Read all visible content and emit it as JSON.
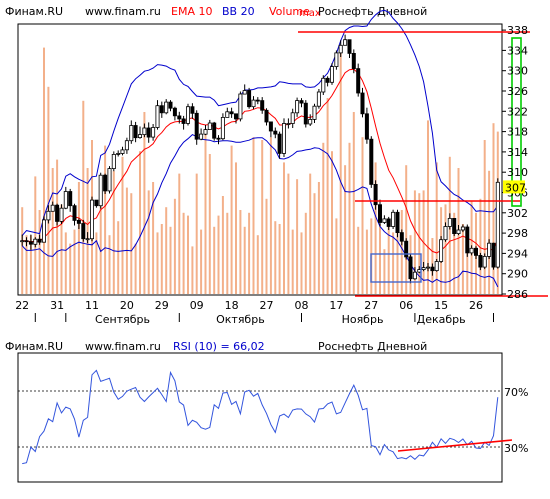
{
  "colors": {
    "background": "#ffffff",
    "plot_bg": "#ffffff",
    "candle": "#000000",
    "ema": "#ff0000",
    "bb": "#0000cc",
    "volume": "#f3b08a",
    "rsi": "#3355dd",
    "annotation_red": "#ff0000",
    "price_tag_bg": "#ffff00",
    "highlight_box": "#4466cc",
    "green_bracket": "#00cc00"
  },
  "main_header": {
    "source": "Финам.RU",
    "url": "www.finam.ru",
    "ema": "EMA 10",
    "bb": "BB 20",
    "volume": "Volume",
    "volume_max": "max",
    "ticker": "Роснефть Дневной"
  },
  "rsi_header": {
    "source": "Финам.RU",
    "url": "www.finam.ru",
    "indicator": "RSI (10) = 66,02",
    "ticker": "Роснефть Дневной"
  },
  "price_axis": {
    "ticks": [
      "338",
      "334",
      "330",
      "326",
      "322",
      "318",
      "314",
      "310",
      "306",
      "302",
      "298",
      "294",
      "290",
      "286"
    ],
    "last_price": "307"
  },
  "date_axis": {
    "day_labels": [
      "22",
      "31",
      "11",
      "20",
      "29",
      "09",
      "18",
      "27",
      "08",
      "17",
      "27",
      "06",
      "15",
      "26"
    ],
    "month_labels": [
      "Сентябрь",
      "Октябрь",
      "Ноябрь",
      "Декабрь"
    ]
  },
  "rsi_axis": {
    "levels": [
      "70%",
      "30%"
    ]
  },
  "chart_data": [
    {
      "type": "candlestick",
      "title": "Роснефть Дневной",
      "ylim": [
        286,
        339
      ],
      "x_count": 110,
      "close": [
        296.5,
        296.3,
        295.8,
        296.8,
        296.2,
        300.6,
        302.3,
        303.5,
        300.3,
        302.9,
        306.2,
        303.4,
        300.5,
        299.9,
        296.9,
        296.9,
        304.5,
        303.4,
        309.4,
        306.3,
        310.7,
        313.5,
        313.7,
        314.4,
        316.2,
        319.2,
        316.8,
        317.4,
        318.7,
        316.9,
        318.8,
        323.1,
        321.7,
        323.8,
        322.6,
        321.1,
        320.5,
        319.6,
        322.9,
        321.6,
        316.5,
        317.5,
        318.4,
        319.7,
        316.7,
        316.6,
        320.8,
        321.9,
        321.5,
        320.5,
        325.4,
        326.1,
        322.9,
        324.2,
        324.1,
        322.2,
        319.9,
        318.1,
        317.5,
        313.7,
        319.6,
        319.6,
        321.7,
        324.1,
        323.6,
        319.5,
        320.4,
        323.0,
        325.8,
        328.5,
        327.7,
        330.8,
        333.5,
        335.0,
        336.1,
        333.4,
        330.4,
        325.6,
        321.5,
        316.5,
        307.6,
        303.6,
        300.1,
        300.8,
        299.3,
        302.1,
        298.1,
        296.4,
        293.3,
        289.0,
        290.3,
        290.8,
        291.2,
        291.3,
        290.6,
        292.4,
        296.7,
        299.3,
        300.9,
        297.9,
        298.6,
        299.2,
        294.1,
        295.0,
        293.6,
        291.3,
        293.4,
        296.0,
        291.3,
        308.0
      ],
      "high": [
        297.7,
        297.2,
        297.7,
        297.2,
        297.7,
        301.3,
        303.5,
        304.2,
        303.8,
        303.7,
        307.1,
        306.7,
        303.8,
        300.9,
        300.6,
        298.2,
        305.2,
        304.4,
        309.9,
        309.7,
        311.2,
        314.1,
        314.3,
        315.0,
        316.8,
        320.2,
        319.9,
        319.0,
        319.6,
        319.8,
        319.5,
        324.2,
        323.9,
        324.4,
        324.2,
        322.9,
        321.9,
        321.1,
        323.5,
        323.6,
        322.2,
        318.6,
        319.3,
        320.3,
        319.9,
        317.3,
        321.6,
        322.7,
        322.7,
        321.3,
        325.9,
        327.3,
        326.6,
        325.0,
        324.8,
        324.8,
        322.6,
        319.4,
        318.8,
        318.0,
        320.6,
        320.6,
        322.5,
        324.7,
        324.6,
        324.2,
        321.4,
        323.5,
        326.4,
        329.1,
        328.9,
        331.5,
        334.0,
        336.0,
        337.1,
        336.0,
        334.2,
        331.4,
        326.6,
        322.7,
        317.1,
        308.4,
        304.6,
        301.5,
        301.2,
        302.6,
        302.6,
        298.7,
        297.0,
        293.9,
        291.3,
        291.5,
        292.3,
        292.1,
        292.0,
        292.9,
        297.4,
        300.1,
        301.9,
        300.7,
        299.6,
        299.7,
        299.7,
        295.6,
        295.4,
        294.1,
        294.0,
        296.8,
        296.1,
        308.8
      ],
      "low": [
        295.5,
        295.4,
        294.7,
        295.2,
        295.7,
        296.2,
        299.9,
        303.0,
        299.5,
        299.8,
        302.7,
        302.2,
        299.5,
        298.8,
        296.3,
        296.0,
        296.4,
        303.0,
        302.8,
        305.7,
        305.8,
        310.2,
        313.1,
        313.3,
        313.6,
        315.6,
        315.9,
        316.6,
        316.9,
        315.8,
        316.2,
        318.4,
        320.7,
        321.4,
        322.0,
        320.2,
        319.6,
        318.4,
        319.2,
        320.5,
        315.4,
        316.3,
        317.3,
        318.4,
        316.2,
        315.5,
        316.3,
        320.9,
        320.7,
        319.6,
        320.0,
        325.3,
        322.5,
        322.4,
        323.4,
        321.5,
        319.2,
        316.9,
        316.7,
        312.7,
        313.0,
        318.6,
        318.7,
        320.9,
        322.8,
        318.8,
        319.1,
        319.7,
        322.5,
        325.2,
        326.9,
        327.2,
        330.2,
        332.7,
        335.0,
        332.5,
        329.5,
        324.9,
        320.8,
        315.6,
        306.9,
        302.6,
        299.4,
        299.8,
        298.6,
        298.8,
        297.2,
        295.6,
        292.8,
        288.1,
        288.8,
        290.1,
        290.5,
        290.5,
        289.6,
        290.4,
        292.1,
        296.3,
        298.7,
        297.4,
        297.6,
        298.2,
        293.3,
        293.6,
        292.9,
        290.7,
        290.9,
        292.9,
        290.8,
        291.0
      ],
      "ema": [
        296.5,
        296.5,
        296.3,
        296.4,
        296.4,
        297.1,
        298.0,
        299.0,
        299.2,
        299.8,
        300.9,
        301.4,
        301.2,
        301.0,
        300.3,
        299.7,
        300.6,
        301.0,
        302.6,
        303.3,
        304.6,
        306.2,
        307.6,
        308.9,
        310.2,
        312.0,
        312.8,
        313.6,
        314.5,
        314.9,
        315.6,
        317.0,
        317.8,
        318.9,
        319.6,
        319.9,
        320.0,
        320.0,
        320.5,
        320.7,
        319.9,
        319.5,
        319.3,
        319.4,
        318.9,
        318.5,
        318.9,
        319.5,
        319.9,
        320.0,
        321.0,
        322.0,
        322.1,
        322.4,
        322.7,
        322.6,
        322.1,
        321.3,
        320.6,
        319.3,
        319.3,
        319.4,
        319.8,
        320.6,
        321.1,
        320.8,
        320.8,
        321.1,
        321.9,
        323.1,
        323.9,
        325.1,
        326.6,
        328.1,
        329.6,
        330.2,
        330.3,
        329.5,
        328.0,
        325.9,
        322.6,
        319.1,
        315.7,
        312.9,
        310.4,
        308.9,
        307.0,
        305.1,
        303.0,
        300.4,
        298.6,
        297.2,
        296.1,
        295.2,
        294.4,
        294.1,
        294.6,
        295.4,
        296.4,
        296.7,
        297.0,
        297.4,
        297.0,
        296.6,
        296.0,
        295.1,
        294.8,
        295.0,
        294.5,
        296.9
      ],
      "bb_upper": [
        297.5,
        298.5,
        298.3,
        298.1,
        297.9,
        301.3,
        303.8,
        305.9,
        305.7,
        306.7,
        309.2,
        309.7,
        309.1,
        308.6,
        308.2,
        307.8,
        309.1,
        309.2,
        313.3,
        313.8,
        315.5,
        318.1,
        320.6,
        322.8,
        325.1,
        327.4,
        328.4,
        329.1,
        329.9,
        330.1,
        330.5,
        331.2,
        331.1,
        330.9,
        330.4,
        330.1,
        328.3,
        327.3,
        326.9,
        325.9,
        325.0,
        324.9,
        324.8,
        324.8,
        324.2,
        323.1,
        323.3,
        323.5,
        323.7,
        323.8,
        325.1,
        326.2,
        326.2,
        326.3,
        326.6,
        326.6,
        326.7,
        326.8,
        327.0,
        327.8,
        327.7,
        327.5,
        327.4,
        327.4,
        327.4,
        326.8,
        326.7,
        326.8,
        327.5,
        328.6,
        329.5,
        331.3,
        333.4,
        335.9,
        337.9,
        338.5,
        338.8,
        338.8,
        338.7,
        338.8,
        340.1,
        341.0,
        341.7,
        341.9,
        341.5,
        340.3,
        339.4,
        338.3,
        336.9,
        335.1,
        333.1,
        330.8,
        327.8,
        323.0,
        317.7,
        310.4,
        308.1,
        307.3,
        306.4,
        305.6,
        305.2,
        304.5,
        304.0,
        303.4,
        302.3,
        302.4,
        302.3,
        302.2,
        302.2,
        303.4
      ],
      "bb_lower": [
        295.5,
        294.6,
        294.6,
        294.7,
        294.9,
        294.1,
        293.5,
        293.4,
        294.4,
        294.7,
        294.6,
        295.3,
        295.8,
        296.2,
        296.0,
        295.8,
        295.7,
        296.5,
        294.4,
        295.1,
        294.9,
        294.5,
        294.4,
        294.5,
        294.6,
        294.5,
        295.7,
        297.3,
        299.2,
        301.1,
        304.0,
        305.7,
        307.9,
        309.7,
        311.8,
        313.2,
        314.8,
        315.9,
        316.6,
        317.4,
        317.0,
        316.5,
        316.4,
        316.3,
        316.0,
        316.1,
        316.2,
        316.2,
        316.1,
        315.9,
        315.9,
        316.1,
        316.3,
        316.7,
        316.8,
        316.8,
        316.2,
        315.2,
        314.4,
        312.7,
        312.6,
        312.9,
        313.4,
        314.1,
        314.2,
        314.4,
        314.5,
        314.8,
        314.7,
        314.2,
        313.6,
        312.2,
        310.4,
        308.1,
        306.2,
        306.1,
        306.2,
        306.6,
        307.1,
        306.8,
        303.7,
        301.3,
        299.3,
        298.3,
        297.6,
        297.2,
        296.4,
        295.0,
        293.5,
        291.9,
        290.5,
        289.5,
        288.7,
        288.8,
        288.3,
        288.9,
        288.4,
        288.3,
        288.5,
        289.1,
        289.4,
        290.5,
        290.4,
        290.1,
        290.0,
        289.5,
        289.3,
        289.5,
        289.1,
        287.4
      ],
      "volume": [
        0.31,
        0.21,
        0.21,
        0.42,
        0.3,
        0.88,
        0.74,
        0.45,
        0.48,
        0.32,
        0.22,
        0.18,
        0.23,
        0.4,
        0.69,
        0.45,
        0.55,
        0.22,
        0.36,
        0.53,
        0.21,
        0.44,
        0.26,
        0.49,
        0.38,
        0.36,
        0.18,
        0.51,
        0.65,
        0.37,
        0.4,
        0.22,
        0.25,
        0.31,
        0.24,
        0.34,
        0.43,
        0.29,
        0.28,
        0.17,
        0.43,
        0.23,
        0.59,
        0.5,
        0.24,
        0.28,
        0.35,
        0.29,
        0.53,
        0.47,
        0.3,
        0.24,
        0.29,
        0.56,
        0.21,
        0.55,
        0.34,
        0.56,
        0.26,
        0.25,
        0.47,
        0.43,
        0.23,
        0.41,
        0.22,
        0.29,
        0.43,
        0.36,
        0.4,
        0.54,
        0.7,
        0.51,
        0.27,
        0.88,
        0.46,
        0.54,
        0.65,
        0.24,
        0.56,
        0.23,
        0.27,
        0.47,
        0.25,
        0.16,
        0.26,
        0.22,
        0.27,
        0.3,
        0.46,
        0.21,
        0.37,
        0.36,
        0.37,
        0.62,
        0.2,
        0.47,
        0.31,
        0.32,
        0.49,
        0.29,
        0.45,
        0.25,
        0.21,
        0.33,
        0.29,
        0.34,
        0.55,
        0.44,
        0.61,
        0.58
      ]
    },
    {
      "type": "line",
      "title": "RSI (10) = 66,02",
      "ylim": [
        0,
        100
      ],
      "x_count": 110,
      "values": [
        13.7,
        14.4,
        26.7,
        23.2,
        35.0,
        39.3,
        49.0,
        46.7,
        61.5,
        53.6,
        58.2,
        56.8,
        48.8,
        34.6,
        47.8,
        50.1,
        83.6,
        87.1,
        78.4,
        79.7,
        80.9,
        70.1,
        64.3,
        66.6,
        70.8,
        72.3,
        73.6,
        66.0,
        62.6,
        66.2,
        69.6,
        73.0,
        68.0,
        62.6,
        85.4,
        78.9,
        62.3,
        59.8,
        43.8,
        47.8,
        46.2,
        42.0,
        40.8,
        42.2,
        60.0,
        57.2,
        69.3,
        69.7,
        60.3,
        62.7,
        52.9,
        70.1,
        71.4,
        66.8,
        69.0,
        59.9,
        53.2,
        44.4,
        38.3,
        51.2,
        52.7,
        50.0,
        55.9,
        56.8,
        56.6,
        52.8,
        50.6,
        46.4,
        56.7,
        57.1,
        60.7,
        62.2,
        52.8,
        54.0,
        61.5,
        68.8,
        75.4,
        67.5,
        56.1,
        57.2,
        27.9,
        27.0,
        20.7,
        28.7,
        24.5,
        23.0,
        17.6,
        18.4,
        17.5,
        19.9,
        17.1,
        20.5,
        19.8,
        24.3,
        30.5,
        26.5,
        33.2,
        29.6,
        33.6,
        32.5,
        30.3,
        33.1,
        28.4,
        31.3,
        26.0,
        25.6,
        30.5,
        28.0,
        35.7,
        66.0
      ]
    }
  ]
}
